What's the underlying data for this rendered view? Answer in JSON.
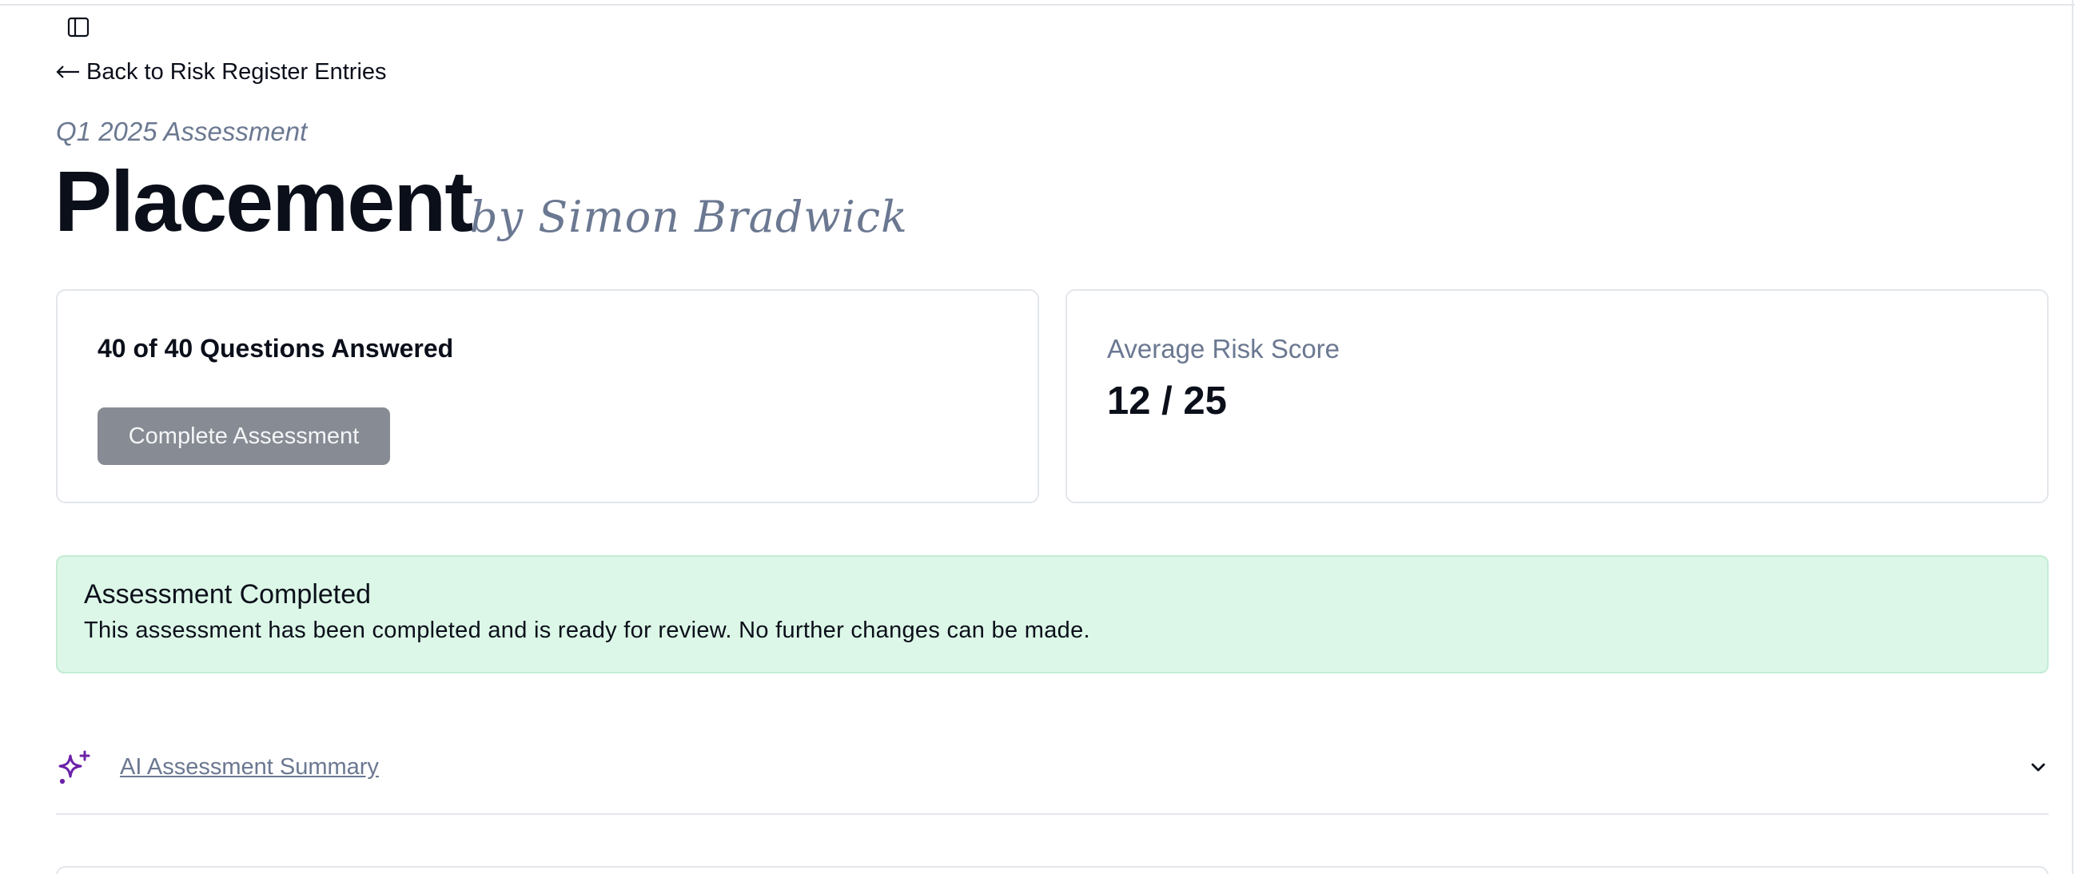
{
  "nav": {
    "back_label": "Back to Risk Register Entries",
    "icons": {
      "sidebar_toggle": "sidebar-toggle-icon",
      "back": "arrow-left-icon"
    }
  },
  "header": {
    "subtitle": "Q1 2025 Assessment",
    "title": "Placement",
    "author": "by Simon Bradwick"
  },
  "progress_card": {
    "heading": "40 of 40 Questions Answered",
    "answered": 40,
    "total": 40,
    "complete_button_label": "Complete Assessment"
  },
  "score_card": {
    "label": "Average Risk Score",
    "value": "12 / 25"
  },
  "alert": {
    "title": "Assessment Completed",
    "body": "This assessment has been completed and is ready for review. No further changes can be made."
  },
  "ai_summary": {
    "label": "AI Assessment Summary",
    "icon": "sparkles-icon",
    "toggle_icon": "chevron-down-icon"
  },
  "colors": {
    "text_primary": "#0b0f1a",
    "text_muted": "#6b7891",
    "button_disabled": "#878b93",
    "success_bg": "#dcf7e7",
    "accent_purple": "#6b21a8",
    "border": "#e3e6ea"
  }
}
